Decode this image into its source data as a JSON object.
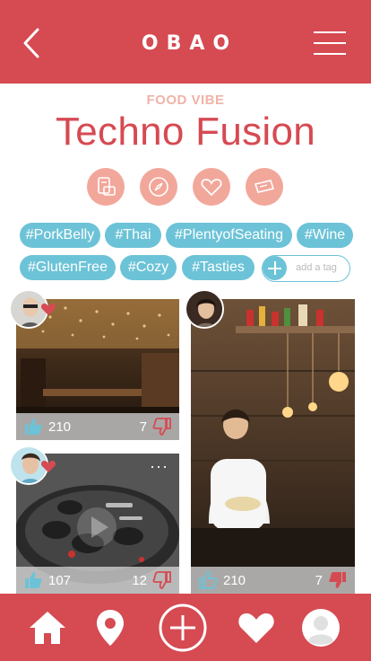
{
  "header": {
    "title": "OBAO"
  },
  "venue": {
    "eyebrow": "FOOD VIBE",
    "name": "Techno Fusion"
  },
  "actions": [
    {
      "icon": "menu-card-icon"
    },
    {
      "icon": "compass-icon"
    },
    {
      "icon": "heart-icon"
    },
    {
      "icon": "ticket-icon"
    }
  ],
  "tags": [
    "#PorkBelly",
    "#Thai",
    "#PlentyofSeating",
    "#Wine",
    "#GlutenFree",
    "#Cozy",
    "#Tasties"
  ],
  "add_tag": {
    "label": "add a tag"
  },
  "posts": [
    {
      "likes": "210",
      "dislikes": "7"
    },
    {
      "likes": "107",
      "dislikes": "12"
    },
    {
      "likes": "210",
      "dislikes": "7"
    }
  ],
  "more": "···",
  "colors": {
    "brand": "#d64a52",
    "tag": "#6cc3d7",
    "accent": "#f2a79b"
  }
}
